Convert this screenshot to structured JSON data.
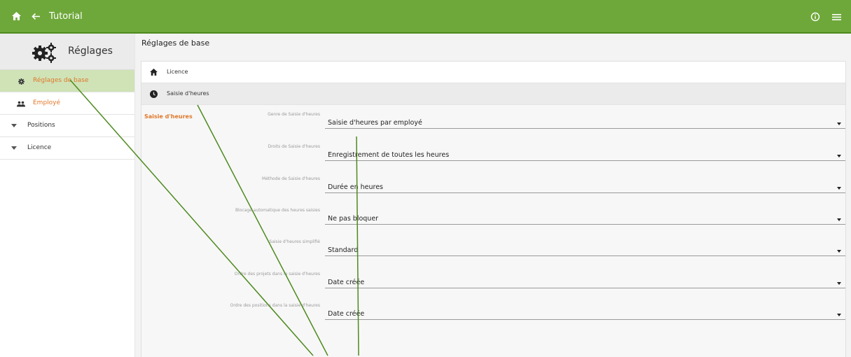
{
  "topbar": {
    "title": "Tutorial",
    "icons": [
      "home-icon",
      "arrow-left-icon",
      "info-icon",
      "menu-icon"
    ],
    "color": "#6ea83a"
  },
  "sidebar": {
    "title": "Réglages",
    "items": [
      {
        "label": "Réglages de base",
        "icon": "gear-icon",
        "active": true
      },
      {
        "label": "Employé",
        "icon": "people-icon"
      },
      {
        "label": "Positions",
        "icon": "triangle-down-icon"
      },
      {
        "label": "Licence",
        "icon": "triangle-down-icon"
      }
    ]
  },
  "main": {
    "title": "Réglages de base",
    "nav": [
      {
        "label": "Licence",
        "icon": "home-icon"
      },
      {
        "label": "Saisie d'heures",
        "icon": "clock-icon",
        "selected": true
      }
    ],
    "section": "Saisie d'heures",
    "fields": [
      {
        "label": "Genre de Saisie d'heures",
        "value": "Saisie d'heures par employé"
      },
      {
        "label": "Droits de Saisie d'heures",
        "value": "Enregistrement de toutes les heures"
      },
      {
        "label": "Méthode de Saisie d'heures",
        "value": "Durée en heures"
      },
      {
        "label": "Blocage automatique des heures saisies",
        "value": "Ne pas bloquer"
      },
      {
        "label": "Saisie d'heures simplifié",
        "value": "Standard"
      },
      {
        "label": "Ordre des projets dans la saisie d'heures",
        "value": "Date créée"
      },
      {
        "label": "Ordre des positions dans la saisie d'heures",
        "value": "Date créée"
      }
    ]
  },
  "colors": {
    "accent": "#e0782a",
    "active_bg": "#cfe3b7",
    "annotation_line": "#4e8a1e"
  }
}
